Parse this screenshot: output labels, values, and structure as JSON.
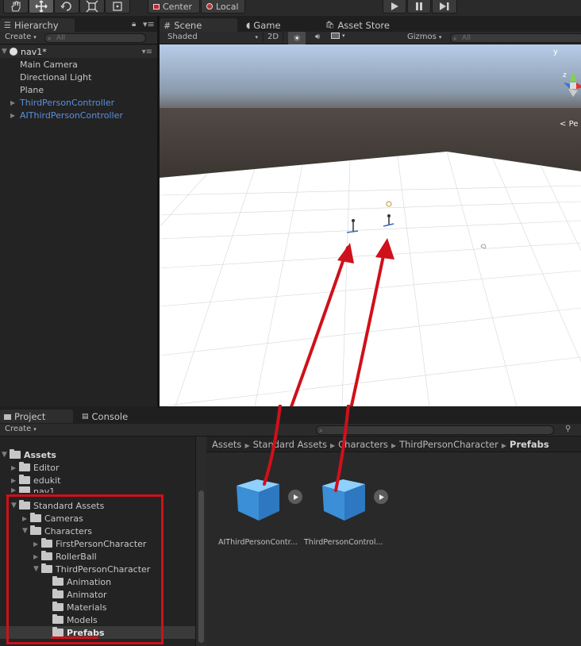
{
  "toolbar": {
    "pivot_label": "Center",
    "space_label": "Local"
  },
  "hierarchy": {
    "tab_label": "Hierarchy",
    "create_label": "Create",
    "search_placeholder": "All",
    "scene_name": "nav1*",
    "items": [
      {
        "label": "Main Camera"
      },
      {
        "label": "Directional Light"
      },
      {
        "label": "Plane"
      },
      {
        "label": "ThirdPersonController"
      },
      {
        "label": "AIThirdPersonController"
      }
    ]
  },
  "scene": {
    "tabs": {
      "scene": "Scene",
      "game": "Game",
      "asset_store": "Asset Store"
    },
    "shading_mode": "Shaded",
    "mode_2d": "2D",
    "gizmos_label": "Gizmos",
    "search_placeholder": "All",
    "persp_label": "Pe",
    "gizmo_axes": {
      "y": "y",
      "z": "z"
    }
  },
  "project": {
    "tab_label": "Project",
    "console_label": "Console",
    "create_label": "Create",
    "tree": {
      "assets": "Assets",
      "editor": "Editor",
      "edukit": "edukit",
      "nav1": "nav1",
      "standard_assets": "Standard Assets",
      "cameras": "Cameras",
      "characters": "Characters",
      "first_person": "FirstPersonCharacter",
      "rollerball": "RollerBall",
      "third_person": "ThirdPersonCharacter",
      "animation": "Animation",
      "animator": "Animator",
      "materials": "Materials",
      "models": "Models",
      "prefabs": "Prefabs"
    },
    "breadcrumb": [
      "Assets",
      "Standard Assets",
      "Characters",
      "ThirdPersonCharacter",
      "Prefabs"
    ],
    "assets": [
      {
        "label": "AIThirdPersonContr..."
      },
      {
        "label": "ThirdPersonControl..."
      }
    ]
  },
  "colors": {
    "annotation_red": "#d0101a",
    "selected_blue": "#5b8fde",
    "prefab_blue": "#3f9be0"
  }
}
